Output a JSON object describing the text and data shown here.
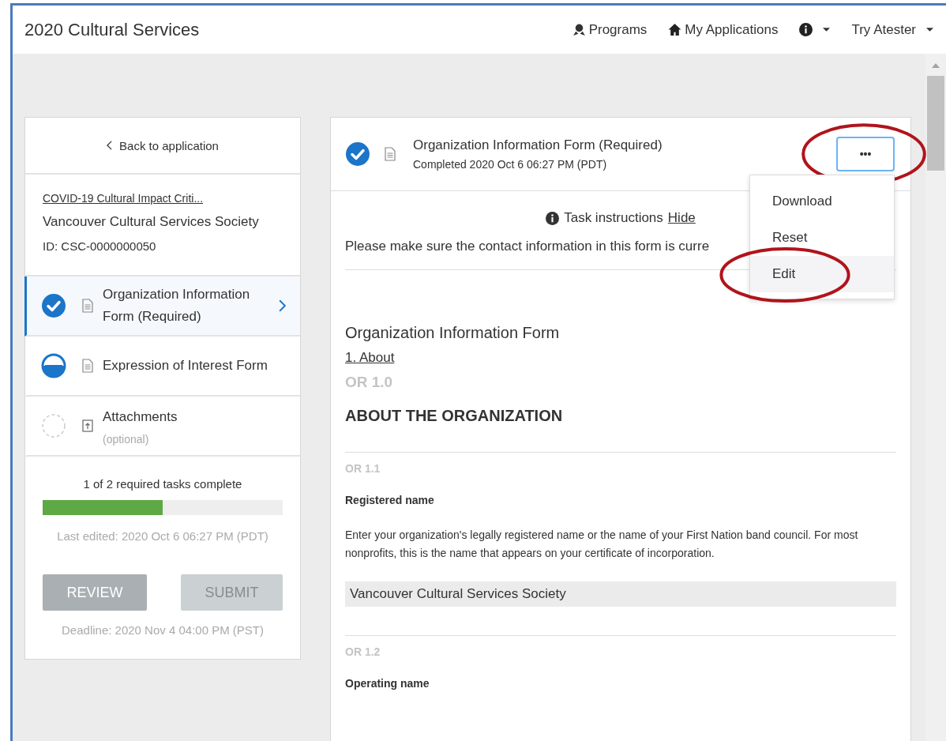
{
  "app_title": "2020 Cultural Services",
  "nav": [
    {
      "kind": "programs",
      "label": "Programs"
    },
    {
      "kind": "applications",
      "label": "My Applications"
    },
    {
      "kind": "info"
    },
    {
      "kind": "user",
      "label": "Try Atester"
    }
  ],
  "sidebar": {
    "back_link": "Back to application",
    "program_link": "COVID-19 Cultural Impact Criti...",
    "organization": "Vancouver Cultural Services Society",
    "application_id": "ID: CSC-0000000050",
    "tasks": [
      {
        "title": "Organization Information Form (Required)",
        "kind": "complete",
        "attachment": false,
        "selected": true
      },
      {
        "title": "Expression of Interest Form",
        "kind": "in_progress",
        "attachment": false,
        "selected": false
      },
      {
        "title": "Attachments",
        "note": "(optional)",
        "kind": "not_started",
        "attachment": true,
        "selected": false
      }
    ],
    "progress": {
      "label": "1 of 2 required tasks complete",
      "level": 0.5
    },
    "last_edited": "Last edited: 2020 Oct 6 06:27 PM (PDT)",
    "buttons": [
      {
        "label": "REVIEW",
        "disabled": true
      },
      {
        "label": "SUBMIT",
        "disabled": true
      }
    ],
    "deadline": "Deadline: 2020 Nov 4 04:00 PM (PST)"
  },
  "task_header": {
    "complete": true,
    "title": "Organization Information Form (Required)",
    "subtitle": "Completed 2020 Oct 6 06:27 PM (PDT)",
    "more_button": {
      "label": "•••",
      "circled": true
    }
  },
  "menu": [
    {
      "label": "Download",
      "selected": false,
      "circled": false
    },
    {
      "label": "Reset",
      "selected": false,
      "circled": false
    },
    {
      "label": "Edit",
      "selected": true,
      "circled": true
    }
  ],
  "instructions": {
    "label": "Task instructions",
    "toggle": "Hide",
    "text": "Please make sure the contact information in this form is curre"
  },
  "form": {
    "title": "Organization Information Form",
    "section_link": "1. About",
    "section_code": "OR 1.0",
    "section_title": "ABOUT THE ORGANIZATION",
    "questions": [
      {
        "code": "OR 1.1",
        "label": "Registered name",
        "help": "Enter your organization's legally registered name or the name of your First Nation band council. For most nonprofits, this is the name that appears on your certificate of incorporation.",
        "value": "Vancouver Cultural Services Society"
      },
      {
        "code": "OR 1.2",
        "label": "Operating name"
      }
    ]
  }
}
